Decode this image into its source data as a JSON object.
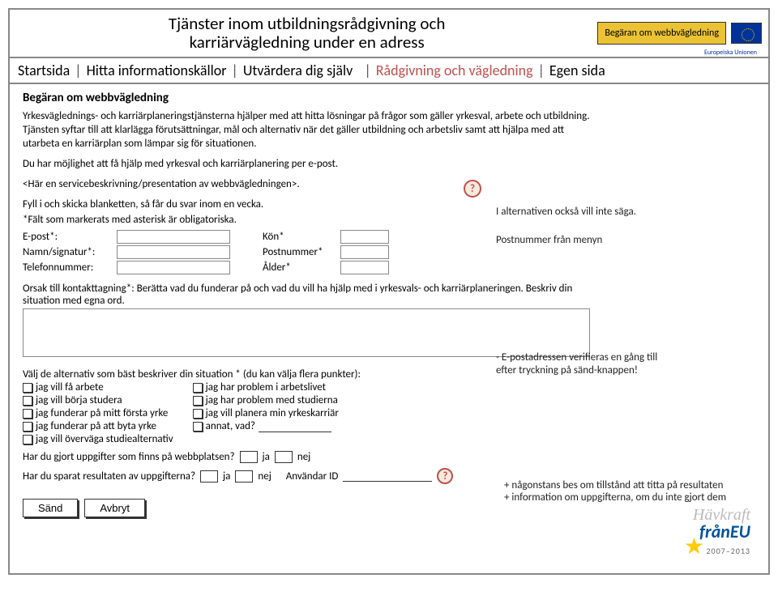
{
  "header": {
    "title_line1": "Tjänster inom utbildningsrådgivning och",
    "title_line2": "karriärvägledning under en adress",
    "badge": "Begäran om webbvägledning",
    "eu_label": "Europeiska Unionen"
  },
  "nav": {
    "items": [
      "Startsida",
      "Hitta informationskällor",
      "Utvärdera dig själv",
      "Rådgivning och vägledning",
      "Egen sida"
    ],
    "active_index": 3
  },
  "section": {
    "title": "Begäran om webbvägledning",
    "intro": "Yrkesväglednings- och karriärplaneringstjänsterna hjälper med att hitta lösningar på frågor som gäller yrkesval, arbete och utbildning. Tjänsten syftar till att klarlägga förutsättningar, mål och alternativ när det gäller utbildning och arbetsliv samt att hjälpa med att utarbeta en karriärplan som lämpar sig för situationen.",
    "line2": "Du har möjlighet att få hjälp med yrkesval och karriärplanering per e-post.",
    "placeholder": "<Här en servicebeskrivning/presentation av webbvägledningen>.",
    "fill": "Fyll i och skicka blanketten, så får du svar  inom en vecka.",
    "mandatory": "*Fält som markerats med asterisk är obligatoriska."
  },
  "fields": {
    "email_label": "E-post*:",
    "name_label": "Namn/signatur*:",
    "phone_label": "Telefonnummer:",
    "gender_label": "Kön*",
    "zip_label": "Postnummer*",
    "age_label": "Ålder*"
  },
  "annotations": {
    "q1": "?",
    "right1": "I alternativen också vill inte säga.",
    "right2": "Postnummer från menyn",
    "right3": "- E-postadressen verifieras en gång till\n   efter tryckning på sänd-knappen!",
    "right4a": "+ någonstans bes om tillstånd att titta på resultaten",
    "right4b": "+ information om uppgifterna, om du inte gjort dem",
    "q2": "?"
  },
  "reason": "Orsak till kontakttagning*: Berätta vad du funderar på och vad du vill ha hjälp med i yrkesvals- och karriärplaneringen. Beskriv din situation med egna ord.",
  "options": {
    "heading": "Välj de alternativ som bäst beskriver din situation * (du kan välja flera punkter):",
    "col1": [
      "jag vill få arbete",
      "jag vill börja studera",
      "jag funderar på mitt första yrke",
      "jag funderar på att byta yrke",
      "jag vill överväga studiealternativ"
    ],
    "col2": [
      "jag har problem i arbetslivet",
      "jag har problem med studierna",
      "jag vill planera min yrkeskarriär",
      "annat, vad?"
    ]
  },
  "questions": {
    "q1": "Har du gjort uppgifter som finns på webbplatsen?",
    "q2": "Har du sparat resultaten av uppgifterna?",
    "yes": "ja",
    "no": "nej",
    "userid": "Användar ID"
  },
  "buttons": {
    "send": "Sänd",
    "cancel": "Avbryt"
  },
  "footer_logo": {
    "top": "Hävkraft",
    "mid": "frånEU",
    "years": "2007–2013"
  }
}
